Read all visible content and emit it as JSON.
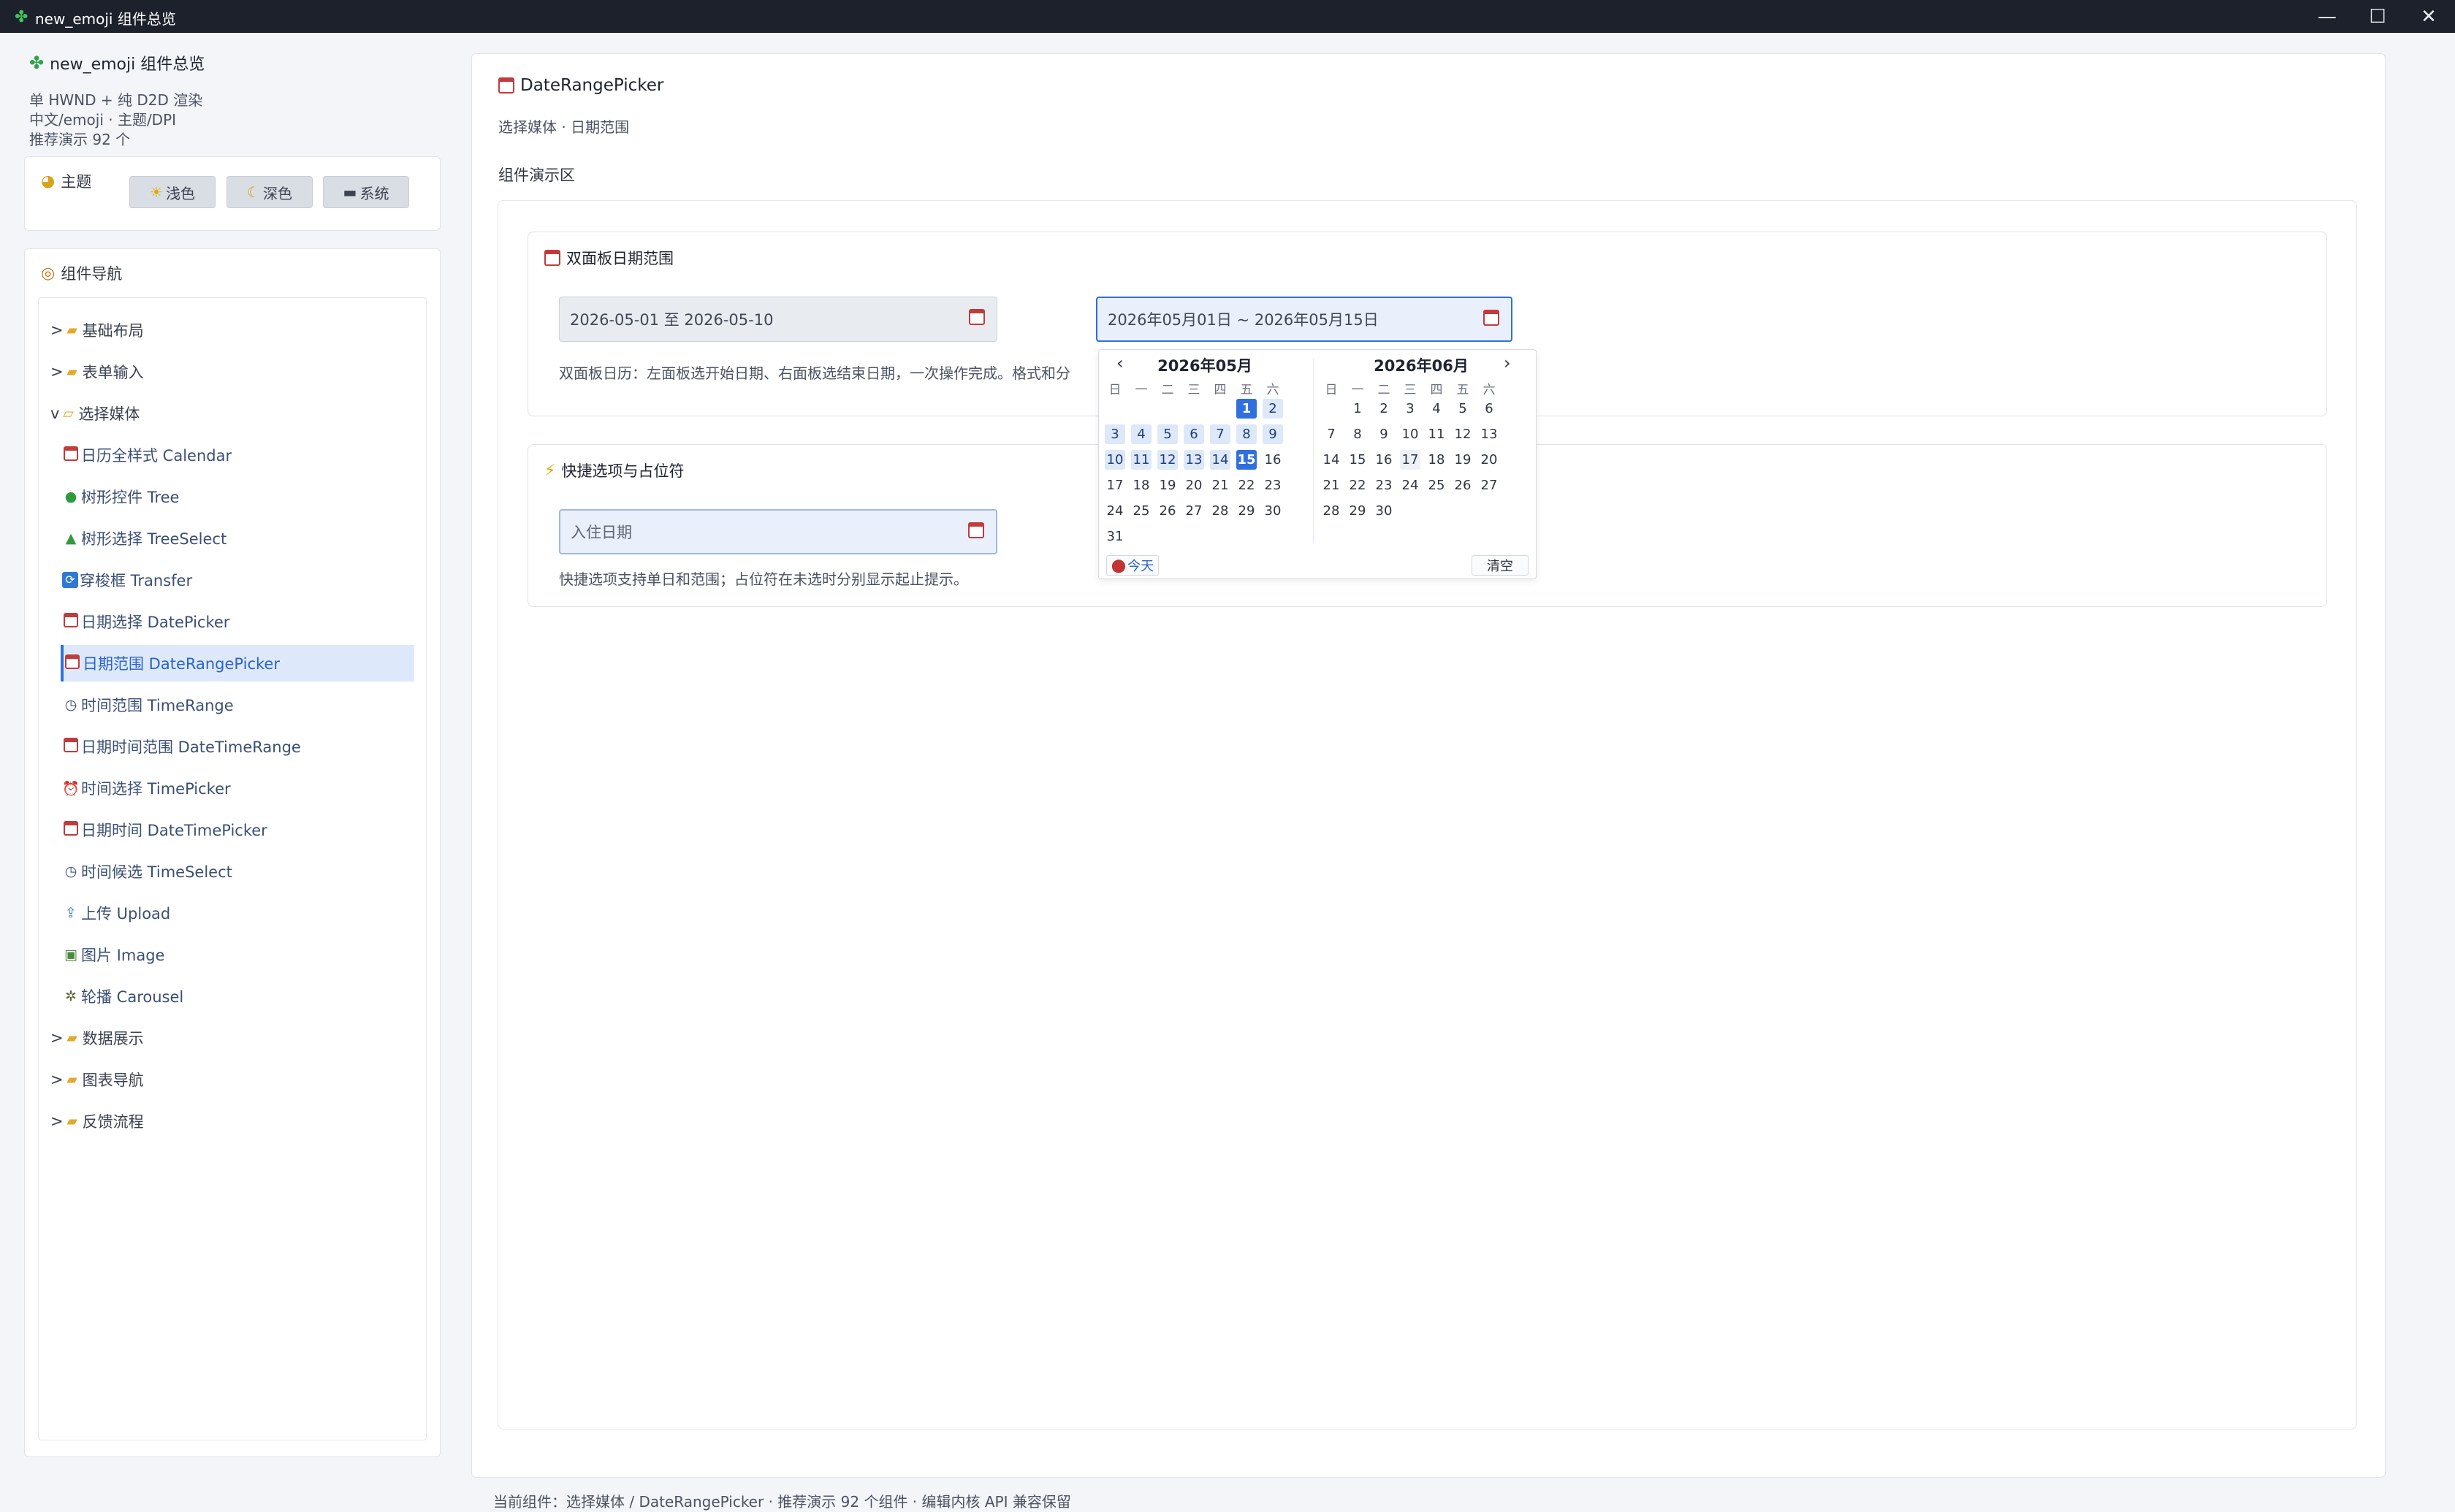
{
  "window": {
    "title": "new_emoji 组件总览",
    "icon": "clover-icon",
    "controls": {
      "minimize": "—",
      "maximize": "☐",
      "close": "✕"
    }
  },
  "sidebar": {
    "app_name": "new_emoji 组件总览",
    "info_lines": [
      "单 HWND + 纯 D2D 渲染",
      "中文/emoji · 主题/DPI",
      "推荐演示 92 个"
    ],
    "theme": {
      "label": "主题",
      "buttons": [
        {
          "label": "浅色",
          "icon": "sun-icon"
        },
        {
          "label": "深色",
          "icon": "moon-icon"
        },
        {
          "label": "系统",
          "icon": "laptop-icon"
        }
      ]
    },
    "nav": {
      "title": "组件导航",
      "groups_top": [
        {
          "prefix": ">",
          "label": "基础布局"
        },
        {
          "prefix": ">",
          "label": "表单输入"
        },
        {
          "prefix": "v",
          "label": "选择媒体"
        }
      ],
      "children": [
        {
          "label": "日历全样式 Calendar",
          "icon": "calendar-icon"
        },
        {
          "label": "树形控件 Tree",
          "icon": "tree-icon"
        },
        {
          "label": "树形选择 TreeSelect",
          "icon": "pine-tree-icon"
        },
        {
          "label": "穿梭框 Transfer",
          "icon": "transfer-icon"
        },
        {
          "label": "日期选择 DatePicker",
          "icon": "calendar-icon"
        },
        {
          "label": "日期范围 DateRangePicker",
          "icon": "calendar-icon",
          "active": true
        },
        {
          "label": "时间范围 TimeRange",
          "icon": "clock-icon"
        },
        {
          "label": "日期时间范围 DateTimeRange",
          "icon": "calendar-icon"
        },
        {
          "label": "时间选择 TimePicker",
          "icon": "alarm-clock-icon"
        },
        {
          "label": "日期时间 DateTimePicker",
          "icon": "calendar-icon"
        },
        {
          "label": "时间候选 TimeSelect",
          "icon": "clock-icon"
        },
        {
          "label": "上传 Upload",
          "icon": "upload-icon"
        },
        {
          "label": "图片 Image",
          "icon": "image-icon"
        },
        {
          "label": "轮播 Carousel",
          "icon": "carousel-icon"
        }
      ],
      "groups_bottom": [
        {
          "prefix": ">",
          "label": "数据展示"
        },
        {
          "prefix": ">",
          "label": "图表导航"
        },
        {
          "prefix": ">",
          "label": "反馈流程"
        }
      ]
    }
  },
  "main": {
    "title": "DateRangePicker",
    "subtitle": "选择媒体 · 日期范围",
    "demo_label": "组件演示区",
    "section1": {
      "title": "双面板日期范围",
      "input_left": "2026-05-01 至 2026-05-10",
      "input_right": "2026年05月01日 ~ 2026年05月15日",
      "description": "双面板日历：左面板选开始日期、右面板选结束日期，一次操作完成。格式和分"
    },
    "section2": {
      "title": "快捷选项与占位符",
      "placeholder": "入住日期",
      "description": "快捷选项支持单日和范围；占位符在未选时分别显示起止提示。"
    },
    "popup": {
      "prev_arrow": "‹",
      "next_arrow": "›",
      "left_month": "2026年05月",
      "right_month": "2026年06月",
      "weekdays": [
        "日",
        "一",
        "二",
        "三",
        "四",
        "五",
        "六"
      ],
      "left_first_weekday": 5,
      "left_days": 31,
      "right_first_weekday": 1,
      "right_days": 30,
      "range_start": 1,
      "range_end": 15,
      "right_today": 17,
      "today_label": "今天",
      "clear_label": "清空"
    }
  },
  "status": "当前组件：选择媒体 / DateRangePicker · 推荐演示 92 个组件 · 编辑内核 API 兼容保留"
}
